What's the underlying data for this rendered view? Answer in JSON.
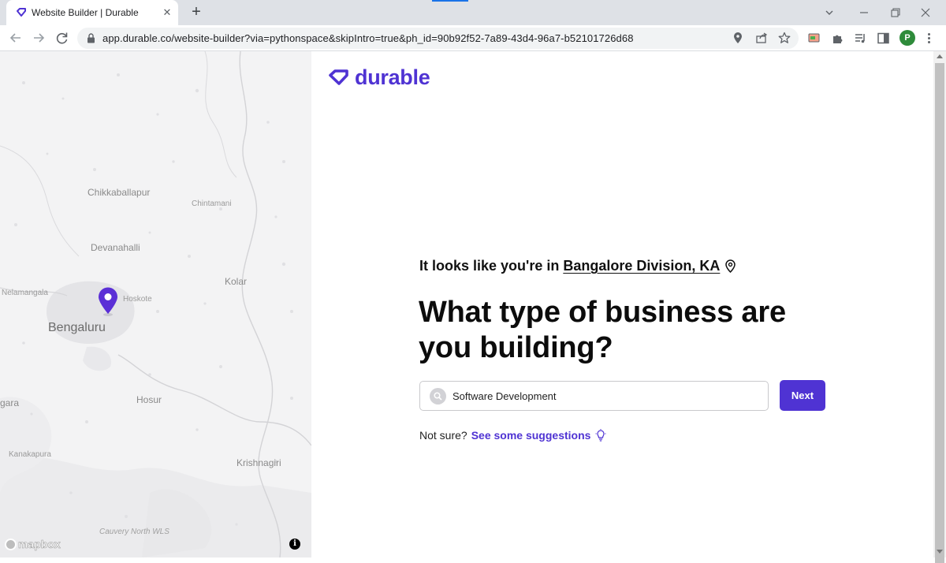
{
  "browser": {
    "tab_title": "Website Builder | Durable",
    "tab_close": "✕",
    "new_tab": "+",
    "url": "app.durable.co/website-builder?via=pythonspace&skipIntro=true&ph_id=90b92f52-7a89-43d4-96a7-b52101726d68",
    "profile_initial": "P",
    "accent_color": "#1a73e8"
  },
  "map": {
    "labels": {
      "chikkaballapur": "Chikkaballapur",
      "chintamani": "Chintamani",
      "devanahalli": "Devanahalli",
      "kolar": "Kolar",
      "nelamangala": "Nelamangala",
      "hoskote": "Hoskote",
      "bengaluru": "Bengaluru",
      "hosur": "Hosur",
      "gara": "gara",
      "kanakapura": "Kanakapura",
      "krishnagiri": "Krishnagiri",
      "cauvery": "Cauvery North WLS"
    },
    "attribution": "mapbox",
    "info": "i",
    "pin_color": "#5b2fd6"
  },
  "brand": {
    "name": "durable",
    "color": "#4f33d3"
  },
  "main": {
    "location_prefix": "It looks like you're in",
    "location_value": "Bangalore Division, KA",
    "headline": "What type of business are you building?",
    "business_input_value": "Software Development",
    "next_label": "Next",
    "not_sure": "Not sure?",
    "suggestions_link": "See some suggestions"
  }
}
